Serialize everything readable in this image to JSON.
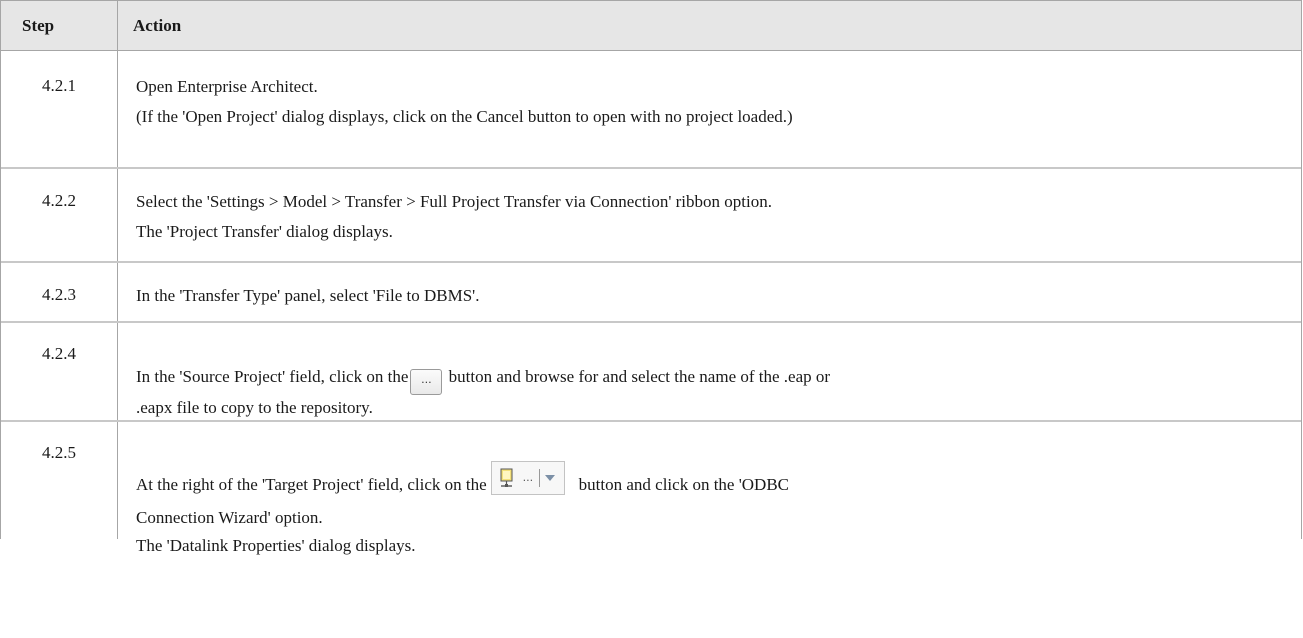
{
  "header": {
    "step": "Step",
    "action": "Action"
  },
  "rows": [
    {
      "step": "4.2.1",
      "lines": [
        "Open Enterprise Architect.",
        "(If the 'Open Project' dialog displays, click on the Cancel button to open with no project loaded.)"
      ]
    },
    {
      "step": "4.2.2",
      "lines": [
        "Select the 'Settings > Model > Transfer > Full Project Transfer via Connection' ribbon option.",
        "The 'Project Transfer' dialog displays."
      ]
    },
    {
      "step": "4.2.3",
      "lines": [
        "In the 'Transfer Type' panel, select 'File to DBMS'."
      ]
    },
    {
      "step": "4.2.4",
      "before": "In the 'Source Project' field, click on the",
      "button_label": "...",
      "after": "button and browse for and select the name of the .eap or",
      "continuation": ".eapx file to copy to the repository."
    },
    {
      "step": "4.2.5",
      "before": "At the right of the 'Target Project' field, click on the",
      "button_label": "...",
      "after": "button and click on the 'ODBC",
      "continuation": "Connection Wizard' option.",
      "line2": "The 'Datalink Properties' dialog displays."
    }
  ],
  "icons": {
    "browse": "ellipsis-button-icon",
    "datasource": "database-connection-icon",
    "dropdown": "dropdown-arrow-icon"
  }
}
